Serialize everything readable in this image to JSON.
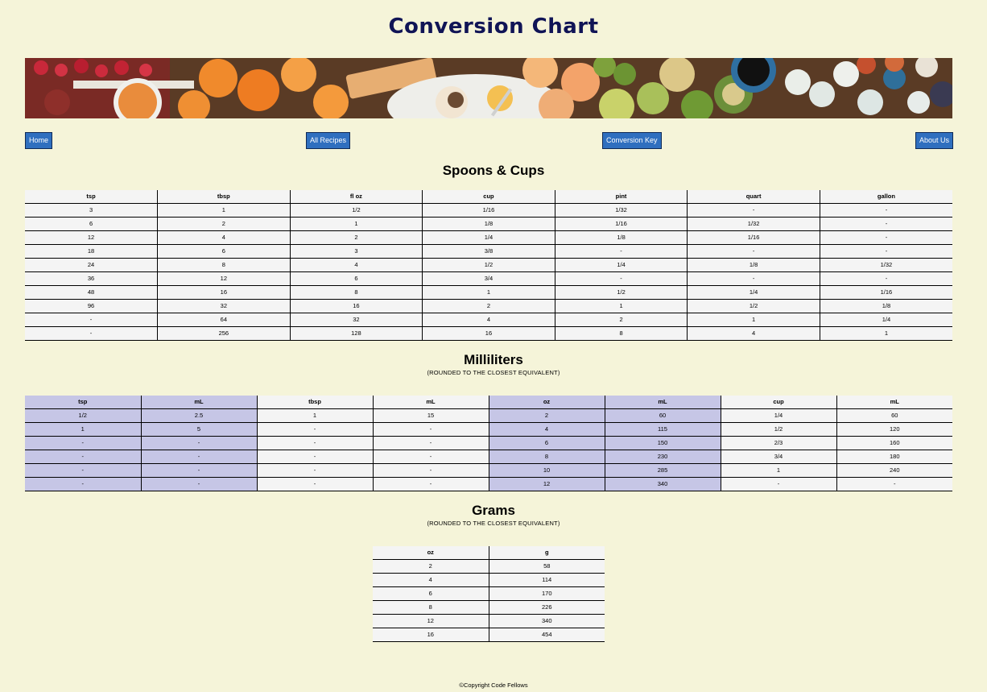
{
  "page": {
    "title": "Conversion Chart",
    "footer": "©Copyright Code Fellows"
  },
  "banner": {
    "description_icon": "food-banner-image"
  },
  "nav": {
    "items": [
      {
        "label": "Home"
      },
      {
        "label": "All Recipes"
      },
      {
        "label": "Conversion Key"
      },
      {
        "label": "About Us"
      }
    ]
  },
  "spoons": {
    "title": "Spoons & Cups",
    "headers": [
      "tsp",
      "tbsp",
      "fl oz",
      "cup",
      "pint",
      "quart",
      "gallon"
    ],
    "rows": [
      [
        "3",
        "1",
        "1/2",
        "1/16",
        "1/32",
        "-",
        "-"
      ],
      [
        "6",
        "2",
        "1",
        "1/8",
        "1/16",
        "1/32",
        "-"
      ],
      [
        "12",
        "4",
        "2",
        "1/4",
        "1/8",
        "1/16",
        "-"
      ],
      [
        "18",
        "6",
        "3",
        "3/8",
        "-",
        "-",
        "-"
      ],
      [
        "24",
        "8",
        "4",
        "1/2",
        "1/4",
        "1/8",
        "1/32"
      ],
      [
        "36",
        "12",
        "6",
        "3/4",
        "-",
        "-",
        "-"
      ],
      [
        "48",
        "16",
        "8",
        "1",
        "1/2",
        "1/4",
        "1/16"
      ],
      [
        "96",
        "32",
        "16",
        "2",
        "1",
        "1/2",
        "1/8"
      ],
      [
        "-",
        "64",
        "32",
        "4",
        "2",
        "1",
        "1/4"
      ],
      [
        "-",
        "256",
        "128",
        "16",
        "8",
        "4",
        "1"
      ]
    ]
  },
  "milliliters": {
    "title": "Milliliters",
    "subtitle": "(ROUNDED TO THE CLOSEST EQUIVALENT)",
    "headers": [
      "tsp",
      "mL",
      "tbsp",
      "mL",
      "oz",
      "mL",
      "cup",
      "mL"
    ],
    "rows": [
      [
        "1/2",
        "2.5",
        "1",
        "15",
        "2",
        "60",
        "1/4",
        "60"
      ],
      [
        "1",
        "5",
        "-",
        "-",
        "4",
        "115",
        "1/2",
        "120"
      ],
      [
        "-",
        "-",
        "-",
        "-",
        "6",
        "150",
        "2/3",
        "160"
      ],
      [
        "-",
        "-",
        "-",
        "-",
        "8",
        "230",
        "3/4",
        "180"
      ],
      [
        "-",
        "-",
        "-",
        "-",
        "10",
        "285",
        "1",
        "240"
      ],
      [
        "-",
        "-",
        "-",
        "-",
        "12",
        "340",
        "-",
        "-"
      ]
    ],
    "shade_color": "#c6c6e6"
  },
  "grams": {
    "title": "Grams",
    "subtitle": "(ROUNDED TO THE CLOSEST EQUIVALENT)",
    "headers": [
      "oz",
      "g"
    ],
    "rows": [
      [
        "2",
        "58"
      ],
      [
        "4",
        "114"
      ],
      [
        "6",
        "170"
      ],
      [
        "8",
        "226"
      ],
      [
        "12",
        "340"
      ],
      [
        "16",
        "454"
      ]
    ]
  },
  "colors": {
    "background": "#f5f4d9",
    "title": "#101456",
    "nav_button": "#2f6fbf",
    "table_cell": "#f4f4f4"
  }
}
